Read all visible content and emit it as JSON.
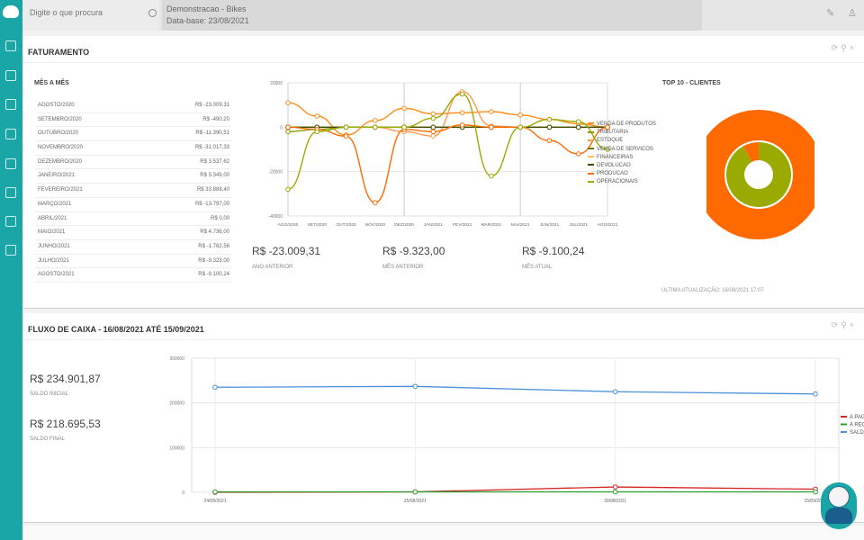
{
  "topbar": {
    "search_placeholder": "Digite o que procura",
    "company_line1": "Demonstracao - Bikes",
    "company_line2": "Data-base: 23/08/2021"
  },
  "faturamento": {
    "title": "FATURAMENTO",
    "mes_a_mes_title": "MÊS A MÊS",
    "rows": [
      {
        "month": "AGOSTO/2020",
        "value": "R$ -23.009,31"
      },
      {
        "month": "SETEMBRO/2020",
        "value": "R$ -490,20"
      },
      {
        "month": "OUTUBRO/2020",
        "value": "R$ -11.390,51"
      },
      {
        "month": "NOVEMBRO/2020",
        "value": "R$ -31.017,33"
      },
      {
        "month": "DEZEMBRO/2020",
        "value": "R$ 3.537,62"
      },
      {
        "month": "JANEIRO/2021",
        "value": "R$ 5.349,00"
      },
      {
        "month": "FEVEREIRO/2021",
        "value": "R$ 33.888,40"
      },
      {
        "month": "MARÇO/2021",
        "value": "R$ -13.797,00"
      },
      {
        "month": "ABRIL/2021",
        "value": "R$ 0,00"
      },
      {
        "month": "MAIO/2021",
        "value": "R$ 4.736,00"
      },
      {
        "month": "JUNHO/2021",
        "value": "R$ -1.762,56"
      },
      {
        "month": "JULHO/2021",
        "value": "R$ -9.323,00"
      },
      {
        "month": "AGOSTO/2021",
        "value": "R$ -9.100,24"
      }
    ],
    "kpis": [
      {
        "value": "R$ -23.009,31",
        "label": "ANO ANTERIOR"
      },
      {
        "value": "R$ -9.323,00",
        "label": "MÊS ANTERIOR"
      },
      {
        "value": "R$ -9.100,24",
        "label": "MÊS ATUAL"
      }
    ],
    "top10_title": "TOP 10 - CLIENTES",
    "last_update": "ÚLTIMA ATUALIZAÇÃO: 16/08/2021 17:07"
  },
  "fluxo": {
    "title": "FLUXO DE CAIXA - 16/08/2021 ATÉ 15/09/2021",
    "saldo_inicial_value": "R$ 234.901,87",
    "saldo_inicial_label": "SALDO INICIAL",
    "saldo_final_value": "R$ 218.695,53",
    "saldo_final_label": "SALDO FINAL"
  },
  "colors": {
    "accent": "#1aa6a6",
    "orange_dark": "#ff6a00",
    "olive": "#9aaa00",
    "a_pagar": "#d62728",
    "a_receber": "#2ca02c",
    "saldo": "#4a90d9"
  },
  "icons": {
    "sidebar": [
      "edit-icon",
      "document-icon",
      "chart-icon",
      "bank-icon",
      "box-icon",
      "transfer-icon",
      "flag-icon",
      "grid-icon"
    ],
    "topbar": [
      "search-icon",
      "pencil-icon",
      "user-icon"
    ],
    "panel": [
      "refresh-icon",
      "pin-icon",
      "close-icon"
    ]
  },
  "chart_data": [
    {
      "type": "line",
      "title": "",
      "categories": [
        "AGO/2020",
        "SET/2020",
        "OUT/2020",
        "NOV/2020",
        "DEZ/2020",
        "JAN/2021",
        "FEV/2021",
        "MAR/2021",
        "MAI/2021",
        "JUN/2021",
        "JUL/2021",
        "AGO/2021"
      ],
      "ylim": [
        -40000,
        20000
      ],
      "yticks": [
        "20000",
        "0",
        "-20000",
        "-40000"
      ],
      "grid": true,
      "legend_position": "right",
      "series": [
        {
          "name": "VENDA DE PRODUTOS",
          "color": "#ff8c1a",
          "values": [
            11000,
            5000,
            -3500,
            3000,
            8500,
            6000,
            6500,
            7000,
            5500,
            3500,
            1500,
            0
          ]
        },
        {
          "name": "TRIBUTARIA",
          "color": "#8c9e00",
          "values": [
            -2000,
            -1000,
            0,
            0,
            0,
            0,
            0,
            0,
            0,
            0,
            0,
            0
          ]
        },
        {
          "name": "ESTOQUE",
          "color": "#ff9a4d",
          "values": [
            0,
            0,
            0,
            0,
            -2000,
            -4000,
            16000,
            500,
            0,
            0,
            0,
            0
          ]
        },
        {
          "name": "VENDA DE SERVICOS",
          "color": "#6e7a00",
          "values": [
            0,
            0,
            0,
            0,
            0,
            0,
            0,
            0,
            0,
            0,
            0,
            0
          ]
        },
        {
          "name": "FINANCEIRAS",
          "color": "#ffc04d",
          "values": [
            0,
            0,
            0,
            0,
            0,
            0,
            0,
            0,
            0,
            0,
            0,
            0
          ]
        },
        {
          "name": "DEVOLUCAO",
          "color": "#3d4a00",
          "values": [
            0,
            0,
            0,
            0,
            0,
            0,
            0,
            0,
            0,
            0,
            0,
            0
          ]
        },
        {
          "name": "PRODUCAO",
          "color": "#ff6a00",
          "values": [
            0,
            -1000,
            -4000,
            -34000,
            -1000,
            -2000,
            1000,
            0,
            0,
            -6000,
            -12000,
            0
          ]
        },
        {
          "name": "OPERACIONAIS",
          "color": "#9aaa00",
          "values": [
            -28000,
            -2000,
            0,
            0,
            0,
            4000,
            15000,
            -22000,
            0,
            3500,
            2500,
            -10000
          ]
        }
      ]
    },
    {
      "type": "pie",
      "title": "TOP 10 - CLIENTES",
      "slices": [
        {
          "label": "",
          "value": 100
        }
      ],
      "inner_ring": [
        {
          "label": "",
          "value": 92
        },
        {
          "label": "",
          "value": 8
        }
      ]
    },
    {
      "type": "line",
      "title": "",
      "categories": [
        "24/08/2021",
        "25/08/2021",
        "30/08/2021",
        "15/09/2021"
      ],
      "ylim": [
        0,
        300000
      ],
      "yticks": [
        "300000",
        "200000",
        "100000",
        "0"
      ],
      "grid": true,
      "legend_position": "right",
      "series": [
        {
          "name": "A PAGAR",
          "color": "#d62728",
          "values": [
            0,
            1000,
            12000,
            7000
          ]
        },
        {
          "name": "A RECEBER",
          "color": "#2ca02c",
          "values": [
            1000,
            1000,
            1000,
            1000
          ]
        },
        {
          "name": "SALDO",
          "color": "#4a90d9",
          "values": [
            235000,
            237000,
            225000,
            220000
          ]
        }
      ]
    }
  ]
}
